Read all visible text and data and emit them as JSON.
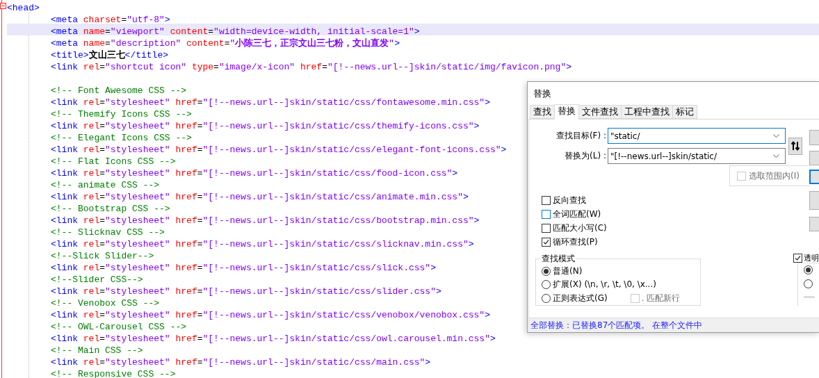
{
  "editor": {
    "lines": [
      {
        "expanded": true,
        "selected": false,
        "tokens": [
          {
            "kind": "tag",
            "text": "<head>"
          }
        ],
        "children": [
          {
            "selected": false,
            "tokens": [
              {
                "kind": "tag",
                "text": "<meta"
              },
              {
                "kind": "attr",
                "text": " charset"
              },
              {
                "kind": "op",
                "text": "="
              },
              {
                "kind": "val",
                "text": "\"utf-8\""
              },
              {
                "kind": "tag",
                "text": ">"
              }
            ]
          },
          {
            "selected": true,
            "tokens": [
              {
                "kind": "tag",
                "text": "<meta"
              },
              {
                "kind": "attr",
                "text": " name"
              },
              {
                "kind": "op",
                "text": "="
              },
              {
                "kind": "val",
                "text": "\"viewport\""
              },
              {
                "kind": "attr",
                "text": " content"
              },
              {
                "kind": "op",
                "text": "="
              },
              {
                "kind": "val",
                "text": "\"width=device-width, initial-scale=1\""
              },
              {
                "kind": "tag",
                "text": ">"
              }
            ]
          },
          {
            "selected": false,
            "tokens": [
              {
                "kind": "tag",
                "text": "<meta"
              },
              {
                "kind": "attr",
                "text": " name"
              },
              {
                "kind": "op",
                "text": "="
              },
              {
                "kind": "val",
                "text": "\"description\""
              },
              {
                "kind": "attr",
                "text": " content"
              },
              {
                "kind": "op",
                "text": "="
              },
              {
                "kind": "val",
                "text": "\""
              },
              {
                "kind": "valbold",
                "text": "小陈三七，正宗文山三七粉，文山直发"
              },
              {
                "kind": "val",
                "text": "\""
              },
              {
                "kind": "tag",
                "text": ">"
              }
            ]
          },
          {
            "selected": false,
            "tokens": [
              {
                "kind": "tag",
                "text": "<title>"
              },
              {
                "kind": "bold",
                "text": "文山三七"
              },
              {
                "kind": "tag",
                "text": "</title>"
              }
            ]
          },
          {
            "selected": false,
            "tokens": [
              {
                "kind": "tag",
                "text": "<link"
              },
              {
                "kind": "attr",
                "text": " rel"
              },
              {
                "kind": "op",
                "text": "="
              },
              {
                "kind": "val",
                "text": "\"shortcut icon\""
              },
              {
                "kind": "attr",
                "text": " type"
              },
              {
                "kind": "op",
                "text": "="
              },
              {
                "kind": "val",
                "text": "\"image/x-icon\""
              },
              {
                "kind": "attr",
                "text": " href"
              },
              {
                "kind": "op",
                "text": "="
              },
              {
                "kind": "val",
                "text": "\"[!--news.url--]skin/static/img/favicon.png\""
              },
              {
                "kind": "tag",
                "text": ">"
              }
            ]
          },
          {
            "selected": false
          },
          {
            "selected": false,
            "tokens": [
              {
                "kind": "cmt",
                "text": "<!-- Font Awesome CSS -->"
              }
            ]
          },
          {
            "selected": false,
            "tokens": [
              {
                "kind": "tag",
                "text": "<link"
              },
              {
                "kind": "attr",
                "text": " rel"
              },
              {
                "kind": "op",
                "text": "="
              },
              {
                "kind": "val",
                "text": "\"stylesheet\""
              },
              {
                "kind": "attr",
                "text": " href"
              },
              {
                "kind": "op",
                "text": "="
              },
              {
                "kind": "val",
                "text": "\"[!--news.url--]skin/static/css/fontawesome.min.css\""
              },
              {
                "kind": "tag",
                "text": ">"
              }
            ]
          },
          {
            "selected": false,
            "tokens": [
              {
                "kind": "cmt",
                "text": "<!-- Themify Icons CSS -->"
              }
            ]
          },
          {
            "selected": false,
            "tokens": [
              {
                "kind": "tag",
                "text": "<link"
              },
              {
                "kind": "attr",
                "text": " rel"
              },
              {
                "kind": "op",
                "text": "="
              },
              {
                "kind": "val",
                "text": "\"stylesheet\""
              },
              {
                "kind": "attr",
                "text": " href"
              },
              {
                "kind": "op",
                "text": "="
              },
              {
                "kind": "val",
                "text": "\"[!--news.url--]skin/static/css/themify-icons.css\""
              },
              {
                "kind": "tag",
                "text": ">"
              }
            ]
          },
          {
            "selected": false,
            "tokens": [
              {
                "kind": "cmt",
                "text": "<!-- Elegant Icons CSS -->"
              }
            ]
          },
          {
            "selected": false,
            "tokens": [
              {
                "kind": "tag",
                "text": "<link"
              },
              {
                "kind": "attr",
                "text": " rel"
              },
              {
                "kind": "op",
                "text": "="
              },
              {
                "kind": "val",
                "text": "\"stylesheet\""
              },
              {
                "kind": "attr",
                "text": " href"
              },
              {
                "kind": "op",
                "text": "="
              },
              {
                "kind": "val",
                "text": "\"[!--news.url--]skin/static/css/elegant-font-icons.css\""
              },
              {
                "kind": "tag",
                "text": ">"
              }
            ]
          },
          {
            "selected": false,
            "tokens": [
              {
                "kind": "cmt",
                "text": "<!-- Flat Icons CSS -->"
              }
            ]
          },
          {
            "selected": false,
            "tokens": [
              {
                "kind": "tag",
                "text": "<link"
              },
              {
                "kind": "attr",
                "text": " rel"
              },
              {
                "kind": "op",
                "text": "="
              },
              {
                "kind": "val",
                "text": "\"stylesheet\""
              },
              {
                "kind": "attr",
                "text": " href"
              },
              {
                "kind": "op",
                "text": "="
              },
              {
                "kind": "val",
                "text": "\"[!--news.url--]skin/static/css/food-icon.css\""
              },
              {
                "kind": "tag",
                "text": ">"
              }
            ]
          },
          {
            "selected": false,
            "tokens": [
              {
                "kind": "cmt",
                "text": "<!-- animate CSS -->"
              }
            ]
          },
          {
            "selected": false,
            "tokens": [
              {
                "kind": "tag",
                "text": "<link"
              },
              {
                "kind": "attr",
                "text": " rel"
              },
              {
                "kind": "op",
                "text": "="
              },
              {
                "kind": "val",
                "text": "\"stylesheet\""
              },
              {
                "kind": "attr",
                "text": " href"
              },
              {
                "kind": "op",
                "text": "="
              },
              {
                "kind": "val",
                "text": "\"[!--news.url--]skin/static/css/animate.min.css\""
              },
              {
                "kind": "tag",
                "text": ">"
              }
            ]
          },
          {
            "selected": false,
            "tokens": [
              {
                "kind": "cmt",
                "text": "<!-- Bootstrap CSS -->"
              }
            ]
          },
          {
            "selected": false,
            "tokens": [
              {
                "kind": "tag",
                "text": "<link"
              },
              {
                "kind": "attr",
                "text": " rel"
              },
              {
                "kind": "op",
                "text": "="
              },
              {
                "kind": "val",
                "text": "\"stylesheet\""
              },
              {
                "kind": "attr",
                "text": " href"
              },
              {
                "kind": "op",
                "text": "="
              },
              {
                "kind": "val",
                "text": "\"[!--news.url--]skin/static/css/bootstrap.min.css\""
              },
              {
                "kind": "tag",
                "text": ">"
              }
            ]
          },
          {
            "selected": false,
            "tokens": [
              {
                "kind": "cmt",
                "text": "<!-- Slicknav CSS -->"
              }
            ]
          },
          {
            "selected": false,
            "tokens": [
              {
                "kind": "tag",
                "text": "<link"
              },
              {
                "kind": "attr",
                "text": " rel"
              },
              {
                "kind": "op",
                "text": "="
              },
              {
                "kind": "val",
                "text": "\"stylesheet\""
              },
              {
                "kind": "attr",
                "text": " href"
              },
              {
                "kind": "op",
                "text": "="
              },
              {
                "kind": "val",
                "text": "\"[!--news.url--]skin/static/css/slicknav.min.css\""
              },
              {
                "kind": "tag",
                "text": ">"
              }
            ]
          },
          {
            "selected": false,
            "tokens": [
              {
                "kind": "cmt",
                "text": "<!--Slick Slider-->"
              }
            ]
          },
          {
            "selected": false,
            "tokens": [
              {
                "kind": "tag",
                "text": "<link"
              },
              {
                "kind": "attr",
                "text": " rel"
              },
              {
                "kind": "op",
                "text": "="
              },
              {
                "kind": "val",
                "text": "\"stylesheet\""
              },
              {
                "kind": "attr",
                "text": " href"
              },
              {
                "kind": "op",
                "text": "="
              },
              {
                "kind": "val",
                "text": "\"[!--news.url--]skin/static/css/slick.css\""
              },
              {
                "kind": "tag",
                "text": ">"
              }
            ]
          },
          {
            "selected": false,
            "tokens": [
              {
                "kind": "cmt",
                "text": "<!--Slider CSS-->"
              }
            ]
          },
          {
            "selected": false,
            "tokens": [
              {
                "kind": "tag",
                "text": "<link"
              },
              {
                "kind": "attr",
                "text": " rel"
              },
              {
                "kind": "op",
                "text": "="
              },
              {
                "kind": "val",
                "text": "\"stylesheet\""
              },
              {
                "kind": "attr",
                "text": " href"
              },
              {
                "kind": "op",
                "text": "="
              },
              {
                "kind": "val",
                "text": "\"[!--news.url--]skin/static/css/slider.css\""
              },
              {
                "kind": "tag",
                "text": ">"
              }
            ]
          },
          {
            "selected": false,
            "tokens": [
              {
                "kind": "cmt",
                "text": "<!-- Venobox CSS -->"
              }
            ]
          },
          {
            "selected": false,
            "tokens": [
              {
                "kind": "tag",
                "text": "<link"
              },
              {
                "kind": "attr",
                "text": " rel"
              },
              {
                "kind": "op",
                "text": "="
              },
              {
                "kind": "val",
                "text": "\"stylesheet\""
              },
              {
                "kind": "attr",
                "text": " href"
              },
              {
                "kind": "op",
                "text": "="
              },
              {
                "kind": "val",
                "text": "\"[!--news.url--]skin/static/css/venobox/venobox.css\""
              },
              {
                "kind": "tag",
                "text": ">"
              }
            ]
          },
          {
            "selected": false,
            "tokens": [
              {
                "kind": "cmt",
                "text": "<!-- OWL-Carousel CSS -->"
              }
            ]
          },
          {
            "selected": false,
            "tokens": [
              {
                "kind": "tag",
                "text": "<link"
              },
              {
                "kind": "attr",
                "text": " rel"
              },
              {
                "kind": "op",
                "text": "="
              },
              {
                "kind": "val",
                "text": "\"stylesheet\""
              },
              {
                "kind": "attr",
                "text": " href"
              },
              {
                "kind": "op",
                "text": "="
              },
              {
                "kind": "val",
                "text": "\"[!--news.url--]skin/static/css/owl.carousel.min.css\""
              },
              {
                "kind": "tag",
                "text": ">"
              }
            ]
          },
          {
            "selected": false,
            "tokens": [
              {
                "kind": "cmt",
                "text": "<!-- Main CSS -->"
              }
            ]
          },
          {
            "selected": false,
            "tokens": [
              {
                "kind": "tag",
                "text": "<link"
              },
              {
                "kind": "attr",
                "text": " rel"
              },
              {
                "kind": "op",
                "text": "="
              },
              {
                "kind": "val",
                "text": "\"stylesheet\""
              },
              {
                "kind": "attr",
                "text": " href"
              },
              {
                "kind": "op",
                "text": "="
              },
              {
                "kind": "val",
                "text": "\"[!--news.url--]skin/static/css/main.css\""
              },
              {
                "kind": "tag",
                "text": ">"
              }
            ]
          },
          {
            "selected": false,
            "tokens": [
              {
                "kind": "cmt",
                "text": "<!-- Responsive CSS -->"
              }
            ]
          }
        ]
      }
    ]
  },
  "dialog": {
    "title": "替换",
    "tabs": [
      {
        "label": "查找",
        "selected": false
      },
      {
        "label": "替换",
        "selected": true
      },
      {
        "label": "文件查找",
        "selected": false
      },
      {
        "label": "工程中查找",
        "selected": false
      },
      {
        "label": "标记",
        "selected": false
      }
    ],
    "find": {
      "label": "查找目标(F) :",
      "value": "\"static/",
      "focused": true
    },
    "replace": {
      "label": "替换为(L) :",
      "value": "\"[!--news.url--]skin/static/",
      "focused": false
    },
    "in_selection": {
      "label": "选取范围内(I)",
      "checked": false,
      "disabled": true
    },
    "options": [
      {
        "label": "反向查找",
        "checked": false,
        "color": "#333333"
      },
      {
        "label": "全词匹配(W)",
        "checked": false,
        "color": "#0078d7"
      },
      {
        "label": "匹配大小写(C)",
        "checked": false,
        "color": "#333333"
      },
      {
        "label": "循环查找(P)",
        "checked": true,
        "color": "#333333"
      }
    ],
    "search_mode": {
      "title": "查找模式",
      "modes": [
        {
          "label": "普通(N)",
          "selected": true
        },
        {
          "label": "扩展(X) (\\n, \\r, \\t, \\0, \\x...)",
          "selected": false
        },
        {
          "label": "正则表达式(G)",
          "selected": false
        }
      ],
      "dot_newline": {
        "label": ". 匹配新行",
        "checked": false,
        "disabled": true
      }
    },
    "transparency": {
      "label": "透明",
      "checked": true,
      "modes": [
        {
          "selected": true
        },
        {
          "selected": false
        }
      ]
    },
    "side_buttons": [
      {
        "default": false
      },
      {
        "default": false
      },
      {
        "default": true
      },
      {
        "default": false
      },
      {
        "default": false
      }
    ],
    "status": "全部替换：已替换87个匹配项。 在整个文件中"
  }
}
